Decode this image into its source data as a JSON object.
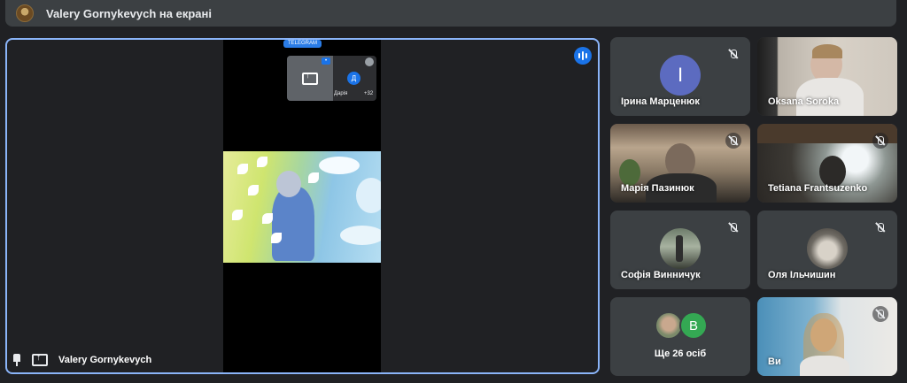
{
  "topbar": {
    "presenter_title": "Valery Gornykevych на екрані"
  },
  "stage": {
    "presenter_name": "Valery Gornykevych",
    "telegram_badge": "TELEGRAM",
    "pip": {
      "name": "Дарія",
      "count": "+32",
      "avatar_letter": "Д"
    }
  },
  "tiles": [
    {
      "name": "Ірина Марценюк",
      "type": "letter",
      "letter": "І",
      "color": "#5c6bc0",
      "muted": true
    },
    {
      "name": "Oksana Soroka",
      "type": "video",
      "muted": false
    },
    {
      "name": "Марія Пазинюк",
      "type": "video",
      "muted": true
    },
    {
      "name": "Tetiana Frantsuzenko",
      "type": "video",
      "muted": true
    },
    {
      "name": "Софія Винничук",
      "type": "photo",
      "muted": true
    },
    {
      "name": "Оля Ільчишин",
      "type": "photo",
      "muted": true
    },
    {
      "name": "Ще 26 осіб",
      "type": "more",
      "letter": "В",
      "color": "#34a853"
    },
    {
      "name": "Ви",
      "type": "video",
      "muted": true
    }
  ]
}
